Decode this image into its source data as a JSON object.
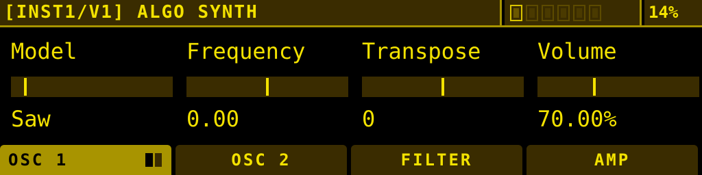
{
  "header": {
    "title": "[INST1/V1] ALGO SYNTH",
    "cpu_load": "14%",
    "page_count": 6,
    "active_page": 1
  },
  "params": [
    {
      "label": "Model",
      "value": "Saw",
      "level": 0.08
    },
    {
      "label": "Frequency",
      "value": "0.00",
      "level": 0.5
    },
    {
      "label": "Transpose",
      "value": "0",
      "level": 0.5
    },
    {
      "label": "Volume",
      "value": "70.00%",
      "level": 0.35
    }
  ],
  "tabs": [
    {
      "label": "OSC 1",
      "active": true
    },
    {
      "label": "OSC 2",
      "active": false
    },
    {
      "label": "FILTER",
      "active": false
    },
    {
      "label": "AMP",
      "active": false
    }
  ],
  "colors": {
    "foreground": "#f3e200",
    "panel": "#3a2c00",
    "accent": "#a89400",
    "background": "#000000"
  }
}
